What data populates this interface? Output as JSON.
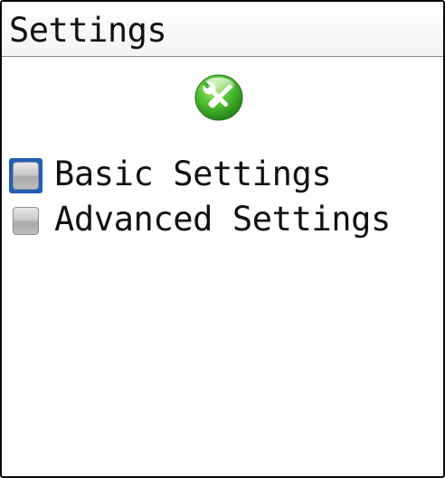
{
  "title_bar": {
    "title": "Settings"
  },
  "header_icon": {
    "name": "wrench-screwdriver-icon",
    "color": "#3fae2a"
  },
  "menu": {
    "items": [
      {
        "label": "Basic Settings",
        "focused": true,
        "icon": "checkbox-icon"
      },
      {
        "label": "Advanced Settings",
        "focused": false,
        "icon": "checkbox-icon"
      }
    ]
  },
  "colors": {
    "focus": "#1f5fb8",
    "text": "#111111",
    "background": "#ffffff"
  }
}
